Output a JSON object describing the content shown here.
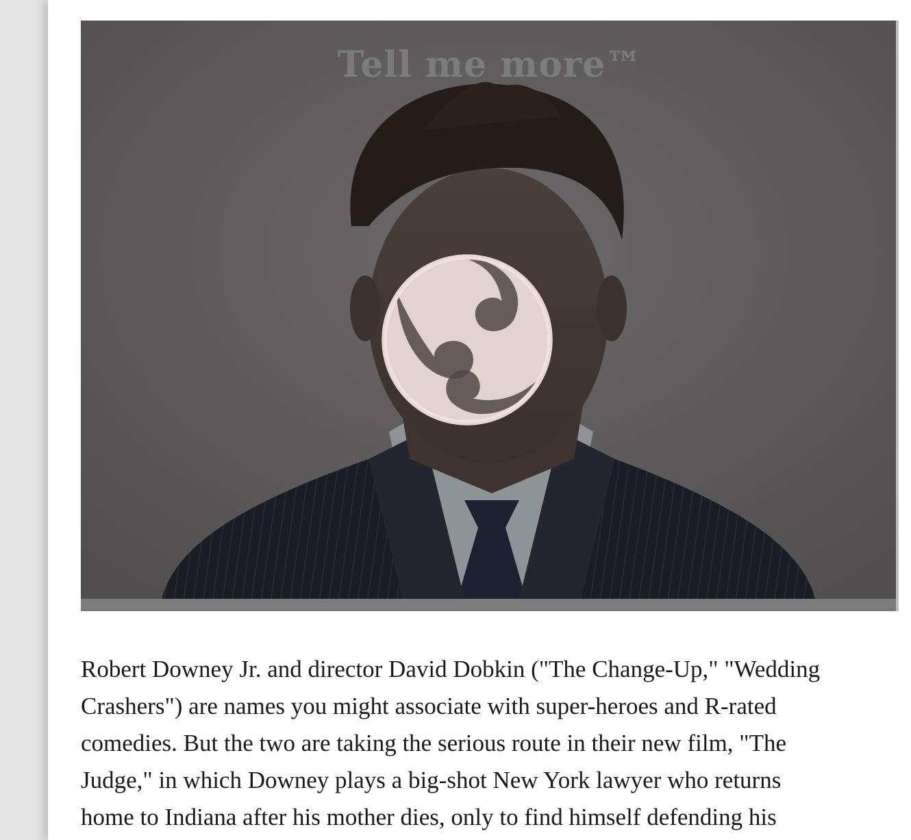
{
  "video": {
    "overlay_title": "Tell me more™",
    "play_icon": "tomoe-swirl-icon"
  },
  "article": {
    "body_lines": "Robert Downey Jr. and director David Dobkin (\"The Change-Up,\" \"Wedding\nCrashers\") are names you might associate with super-heroes and R-rated\ncomedies.  But the two are taking the serious route in their new film, \"The\nJudge,\" in which Downey plays a big-shot New York lawyer who returns\nhome to Indiana after his mother dies, only to find himself defending his"
  },
  "colors": {
    "page_bg": "#e6e6e6",
    "panel_bg": "#ffffff",
    "overlay_tint": "#5f5d5e",
    "text": "#1a1a1a"
  }
}
